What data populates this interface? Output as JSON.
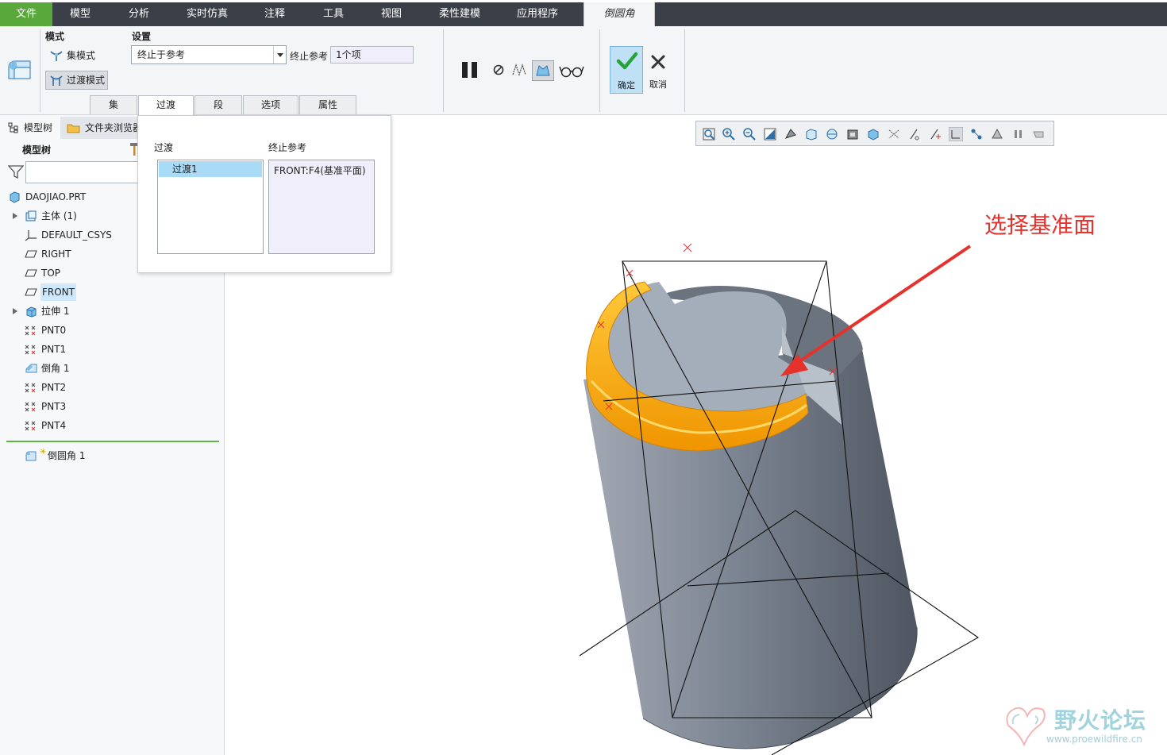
{
  "menubar": {
    "file": "文件",
    "tabs": [
      "模型",
      "分析",
      "实时仿真",
      "注释",
      "工具",
      "视图",
      "柔性建模",
      "应用程序"
    ],
    "active_tab": "倒圆角"
  },
  "ribbon": {
    "mode_label": "模式",
    "set_mode": "集模式",
    "transition_mode": "过渡模式",
    "settings_label": "设置",
    "settings_value": "终止于参考",
    "stop_ref_label": "终止参考",
    "stop_ref_value": "1个项",
    "subtabs": [
      "集",
      "过渡",
      "段",
      "选项",
      "属性"
    ],
    "active_subtab": "过渡",
    "ok": "确定",
    "cancel": "取消"
  },
  "left_panel": {
    "tabs": [
      "模型树",
      "文件夹浏览器"
    ],
    "title": "模型树",
    "filter_placeholder": "",
    "tree": [
      {
        "label": "DAOJIAO.PRT",
        "icon": "part-icon",
        "expandable": false,
        "indent": 0
      },
      {
        "label": "主体 (1)",
        "icon": "body-icon",
        "expandable": true,
        "indent": 1
      },
      {
        "label": "DEFAULT_CSYS",
        "icon": "csys-icon",
        "expandable": false,
        "indent": 1
      },
      {
        "label": "RIGHT",
        "icon": "datum-plane-icon",
        "expandable": false,
        "indent": 1
      },
      {
        "label": "TOP",
        "icon": "datum-plane-icon",
        "expandable": false,
        "indent": 1
      },
      {
        "label": "FRONT",
        "icon": "datum-plane-icon",
        "expandable": false,
        "indent": 1,
        "selected": true
      },
      {
        "label": "拉伸 1",
        "icon": "extrude-icon",
        "expandable": true,
        "indent": 1
      },
      {
        "label": "PNT0",
        "icon": "datum-point-icon",
        "expandable": false,
        "indent": 1
      },
      {
        "label": "PNT1",
        "icon": "datum-point-icon",
        "expandable": false,
        "indent": 1
      },
      {
        "label": "倒角 1",
        "icon": "chamfer-icon",
        "expandable": false,
        "indent": 1
      },
      {
        "label": "PNT2",
        "icon": "datum-point-icon",
        "expandable": false,
        "indent": 1
      },
      {
        "label": "PNT3",
        "icon": "datum-point-icon",
        "expandable": false,
        "indent": 1
      },
      {
        "label": "PNT4",
        "icon": "datum-point-icon",
        "expandable": false,
        "indent": 1
      }
    ],
    "insert_feature": "倒圆角 1"
  },
  "popup": {
    "transitions_label": "过渡",
    "stop_ref_label": "终止参考",
    "transitions": [
      "过渡1"
    ],
    "stop_refs": [
      "FRONT:F4(基准平面)"
    ]
  },
  "viewport": {
    "annotation": "选择基准面",
    "annotation_color": "#e5322d",
    "highlight_color": "#f5a300",
    "body_color": "#8a929e"
  },
  "watermark": {
    "main": "野火论坛",
    "sub": "www.proewildfire.cn"
  }
}
